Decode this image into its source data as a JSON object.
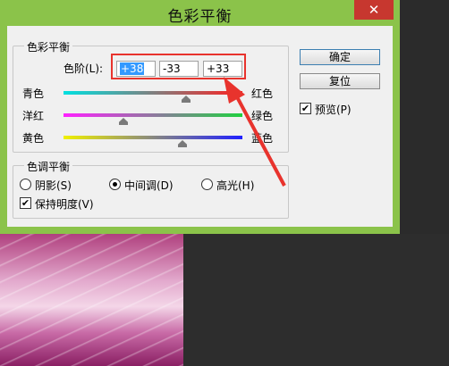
{
  "dialog": {
    "title": "色彩平衡",
    "close_symbol": "✕",
    "color_balance": {
      "legend": "色彩平衡",
      "levels_label": "色阶(L):",
      "levels": [
        "+38",
        "-33",
        "+33"
      ],
      "sliders": [
        {
          "left": "青色",
          "right": "红色",
          "value": 38
        },
        {
          "left": "洋红",
          "right": "绿色",
          "value": -33
        },
        {
          "left": "黄色",
          "right": "蓝色",
          "value": 33
        }
      ]
    },
    "tone_balance": {
      "legend": "色调平衡",
      "shadows": "阴影(S)",
      "midtones": "中间调(D)",
      "highlights": "高光(H)",
      "selected": "midtones",
      "preserve_luminosity": "保持明度(V)",
      "preserve_checked": true
    },
    "ok_label": "确定",
    "reset_label": "复位",
    "preview_label": "预览(P)",
    "preview_checked": true
  },
  "colors": {
    "title_bar": "#8bc34a",
    "close_button": "#c7372f",
    "annotation": "#e8332d"
  }
}
